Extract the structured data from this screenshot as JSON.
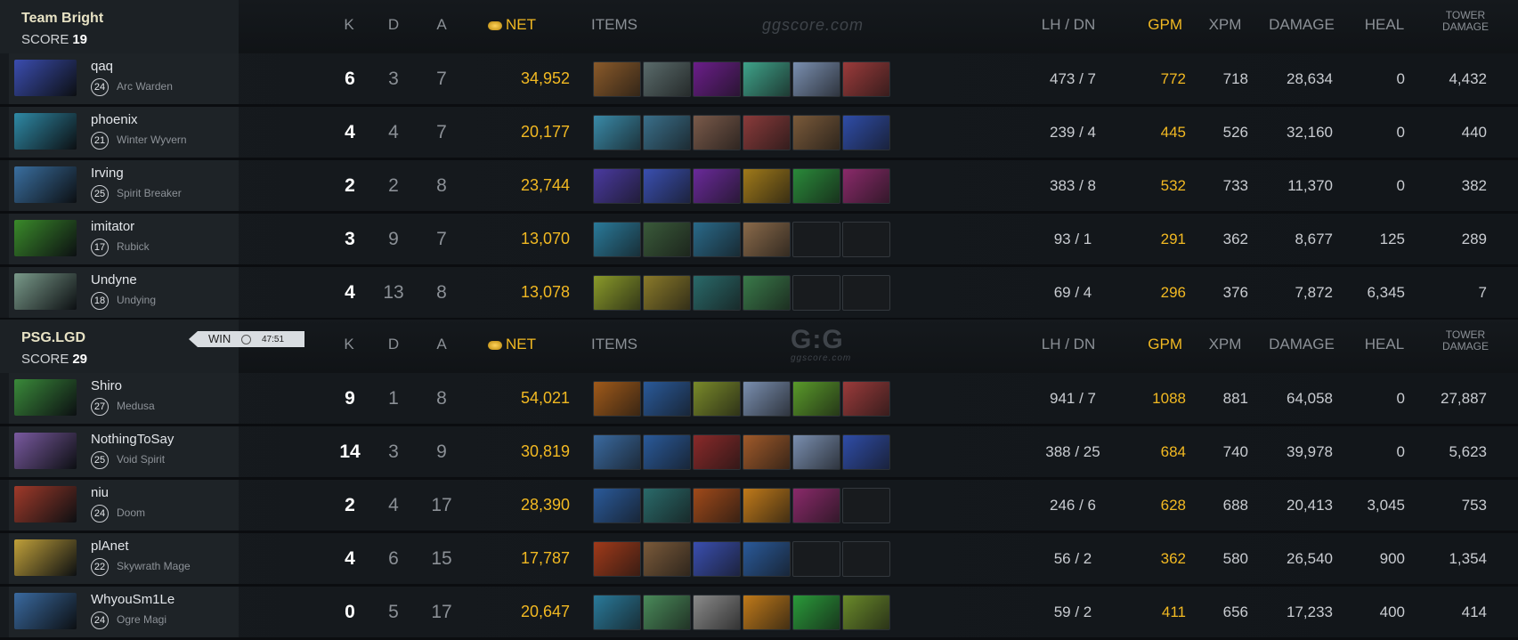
{
  "columns": {
    "k": "K",
    "d": "D",
    "a": "A",
    "net": "NET",
    "items": "ITEMS",
    "lh_dn": "LH  /  DN",
    "gpm": "GPM",
    "xpm": "XPM",
    "damage": "DAMAGE",
    "heal": "HEAL",
    "tower_damage_1": "TOWER",
    "tower_damage_2": "DAMAGE"
  },
  "watermark_top": "ggscore.com",
  "watermark_mid": "G:G",
  "watermark_mid_sub": "ggscore.com",
  "result": {
    "label": "WIN",
    "time": "47:51"
  },
  "teams": [
    {
      "name": "Team Bright",
      "score_label": "SCORE",
      "score": "19",
      "players": [
        {
          "name": "qaq",
          "level": "24",
          "hero": "Arc Warden",
          "k": "6",
          "d": "3",
          "a": "7",
          "net": "34,952",
          "lhdn": "473  /  7",
          "gpm": "772",
          "xpm": "718",
          "damage": "28,634",
          "heal": "0",
          "tower": "4,432",
          "portrait": "#3b4db0",
          "items": [
            "#8a5a2a",
            "#5a6b6b",
            "#6b1e8a",
            "#3fa38a",
            "#7a8fb0",
            "#9b3b3b"
          ]
        },
        {
          "name": "phoenix",
          "level": "21",
          "hero": "Winter Wyvern",
          "k": "4",
          "d": "4",
          "a": "7",
          "net": "20,177",
          "lhdn": "239  /  4",
          "gpm": "445",
          "xpm": "526",
          "damage": "32,160",
          "heal": "0",
          "tower": "440",
          "portrait": "#2f8aa6",
          "items": [
            "#3a8aa8",
            "#3a6f8a",
            "#7a5a4a",
            "#8a3b3b",
            "#7a5a3a",
            "#2f4da8"
          ]
        },
        {
          "name": "Irving",
          "level": "25",
          "hero": "Spirit Breaker",
          "k": "2",
          "d": "2",
          "a": "8",
          "net": "23,744",
          "lhdn": "383  /  8",
          "gpm": "532",
          "xpm": "733",
          "damage": "11,370",
          "heal": "0",
          "tower": "382",
          "portrait": "#3a6fa0",
          "items": [
            "#4a3aa0",
            "#3a4fb0",
            "#6a2a9a",
            "#a07a1a",
            "#2a8a3a",
            "#8a2a6a"
          ]
        },
        {
          "name": "imitator",
          "level": "17",
          "hero": "Rubick",
          "k": "3",
          "d": "9",
          "a": "7",
          "net": "13,070",
          "lhdn": "93  /  1",
          "gpm": "291",
          "xpm": "362",
          "damage": "8,677",
          "heal": "125",
          "tower": "289",
          "portrait": "#3a8a2a",
          "items": [
            "#2a7a9a",
            "#3a5a3a",
            "#2a6a8a",
            "#8a6a4a",
            "",
            ""
          ]
        },
        {
          "name": "Undyne",
          "level": "18",
          "hero": "Undying",
          "k": "4",
          "d": "13",
          "a": "8",
          "net": "13,078",
          "lhdn": "69  /  4",
          "gpm": "296",
          "xpm": "376",
          "damage": "7,872",
          "heal": "6,345",
          "tower": "7",
          "portrait": "#7a9a8a",
          "items": [
            "#8a9a2a",
            "#8a7a2a",
            "#2a6a6a",
            "#3a7a4a",
            "",
            ""
          ]
        }
      ]
    },
    {
      "name": "PSG.LGD",
      "score_label": "SCORE",
      "score": "29",
      "players": [
        {
          "name": "Shiro",
          "level": "27",
          "hero": "Medusa",
          "k": "9",
          "d": "1",
          "a": "8",
          "net": "54,021",
          "lhdn": "941  /  7",
          "gpm": "1088",
          "xpm": "881",
          "damage": "64,058",
          "heal": "0",
          "tower": "27,887",
          "portrait": "#3a8a3a",
          "items": [
            "#a05a1a",
            "#2a5a9a",
            "#7a8a2a",
            "#7a8fb0",
            "#5a9a2a",
            "#9b3b3b"
          ]
        },
        {
          "name": "NothingToSay",
          "level": "25",
          "hero": "Void Spirit",
          "k": "14",
          "d": "3",
          "a": "9",
          "net": "30,819",
          "lhdn": "388  /  25",
          "gpm": "684",
          "xpm": "740",
          "damage": "39,978",
          "heal": "0",
          "tower": "5,623",
          "portrait": "#7a5aa0",
          "items": [
            "#3a6aa0",
            "#2a5a9a",
            "#8a2a2a",
            "#a05a2a",
            "#7a8fb0",
            "#2f4da8"
          ]
        },
        {
          "name": "niu",
          "level": "24",
          "hero": "Doom",
          "k": "2",
          "d": "4",
          "a": "17",
          "net": "28,390",
          "lhdn": "246  /  6",
          "gpm": "628",
          "xpm": "688",
          "damage": "20,413",
          "heal": "3,045",
          "tower": "753",
          "portrait": "#a03a2a",
          "items": [
            "#2a5a9a",
            "#2a6a6a",
            "#a04a1a",
            "#c07a1a",
            "#8a2a6a",
            ""
          ]
        },
        {
          "name": "plAnet",
          "level": "22",
          "hero": "Skywrath Mage",
          "k": "4",
          "d": "6",
          "a": "15",
          "net": "17,787",
          "lhdn": "56  /  2",
          "gpm": "362",
          "xpm": "580",
          "damage": "26,540",
          "heal": "900",
          "tower": "1,354",
          "portrait": "#c0a03a",
          "items": [
            "#a03a1a",
            "#7a5a3a",
            "#3a4fb0",
            "#2a5a9a",
            "",
            ""
          ]
        },
        {
          "name": "WhyouSm1Le",
          "level": "24",
          "hero": "Ogre Magi",
          "k": "0",
          "d": "5",
          "a": "17",
          "net": "20,647",
          "lhdn": "59  /  2",
          "gpm": "411",
          "xpm": "656",
          "damage": "17,233",
          "heal": "400",
          "tower": "414",
          "portrait": "#3a6aa0",
          "items": [
            "#2a7a9a",
            "#4a8a5a",
            "#8a8a8a",
            "#c07a1a",
            "#2a9a3a",
            "#6a8a2a"
          ]
        }
      ]
    }
  ]
}
